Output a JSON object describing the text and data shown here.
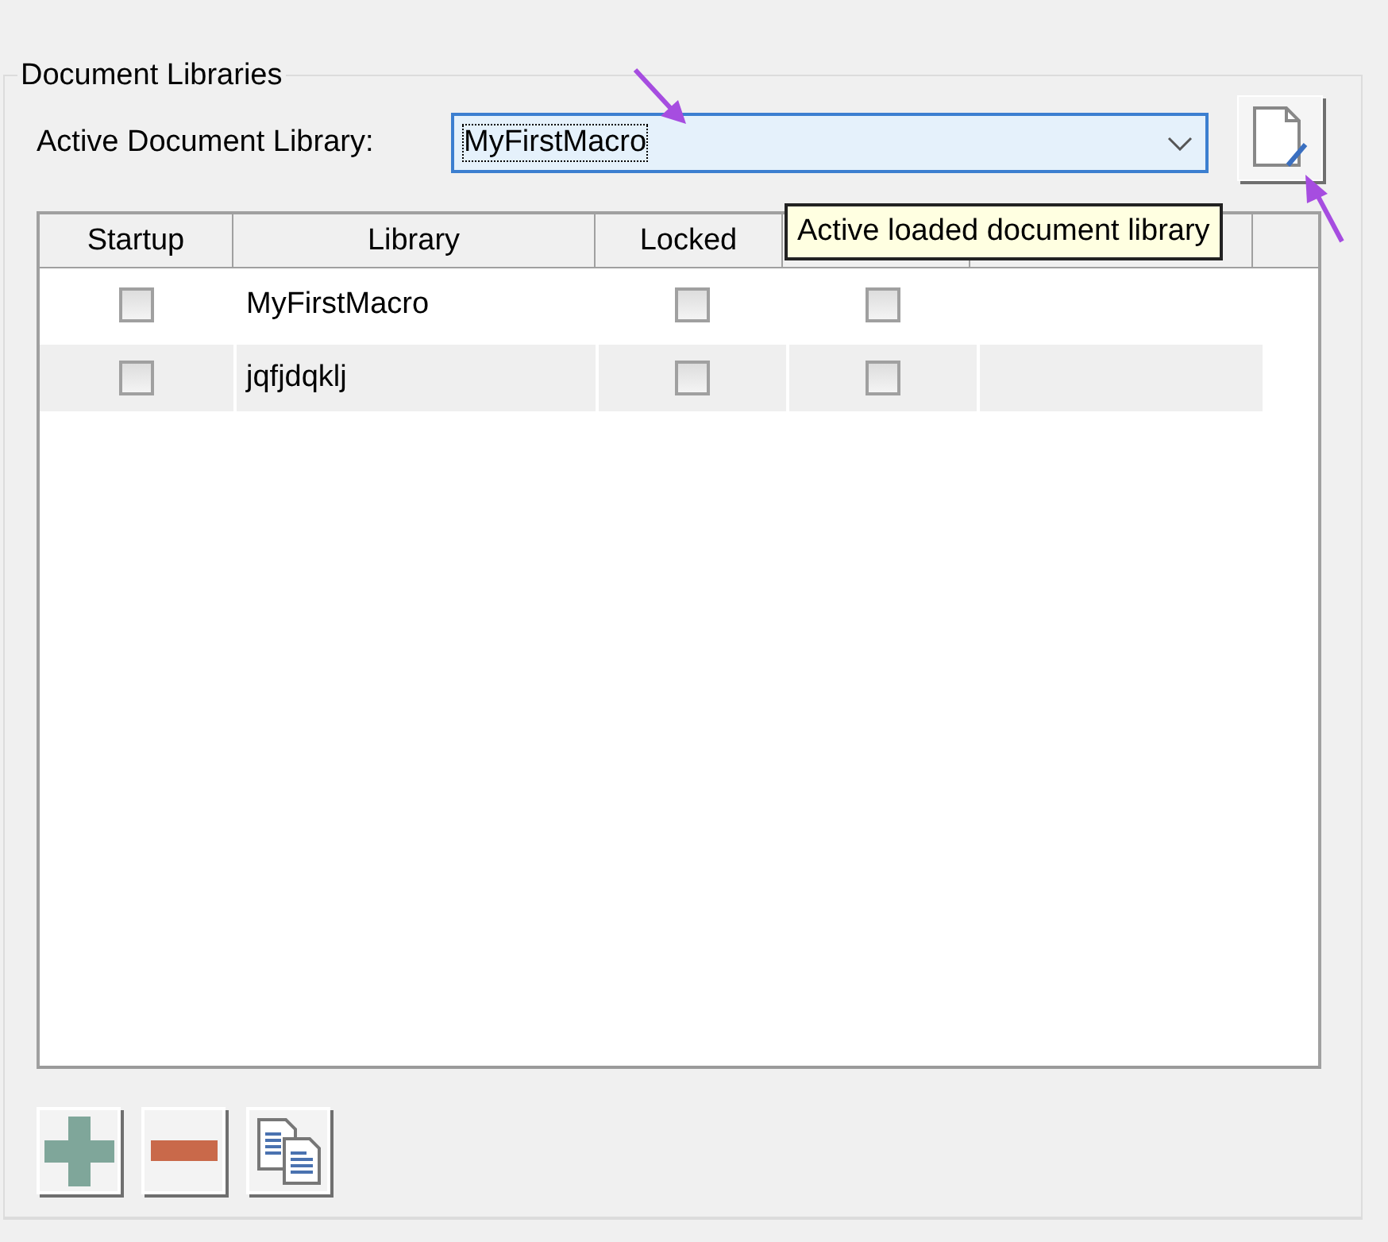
{
  "group": {
    "title": "Document Libraries"
  },
  "active_library": {
    "label": "Active Document Library:",
    "value": "MyFirstMacro"
  },
  "tooltip": {
    "text": "Active loaded document library"
  },
  "table": {
    "columns": [
      "Startup",
      "Library",
      "Locked"
    ],
    "rows": [
      {
        "startup": false,
        "library": "MyFirstMacro",
        "locked": false,
        "column_4": false
      },
      {
        "startup": false,
        "library": "jqfjdqklj",
        "locked": false,
        "column_4": false
      }
    ]
  },
  "buttons": [
    {
      "kind": "add"
    },
    {
      "kind": "remove"
    },
    {
      "kind": "copy"
    }
  ]
}
